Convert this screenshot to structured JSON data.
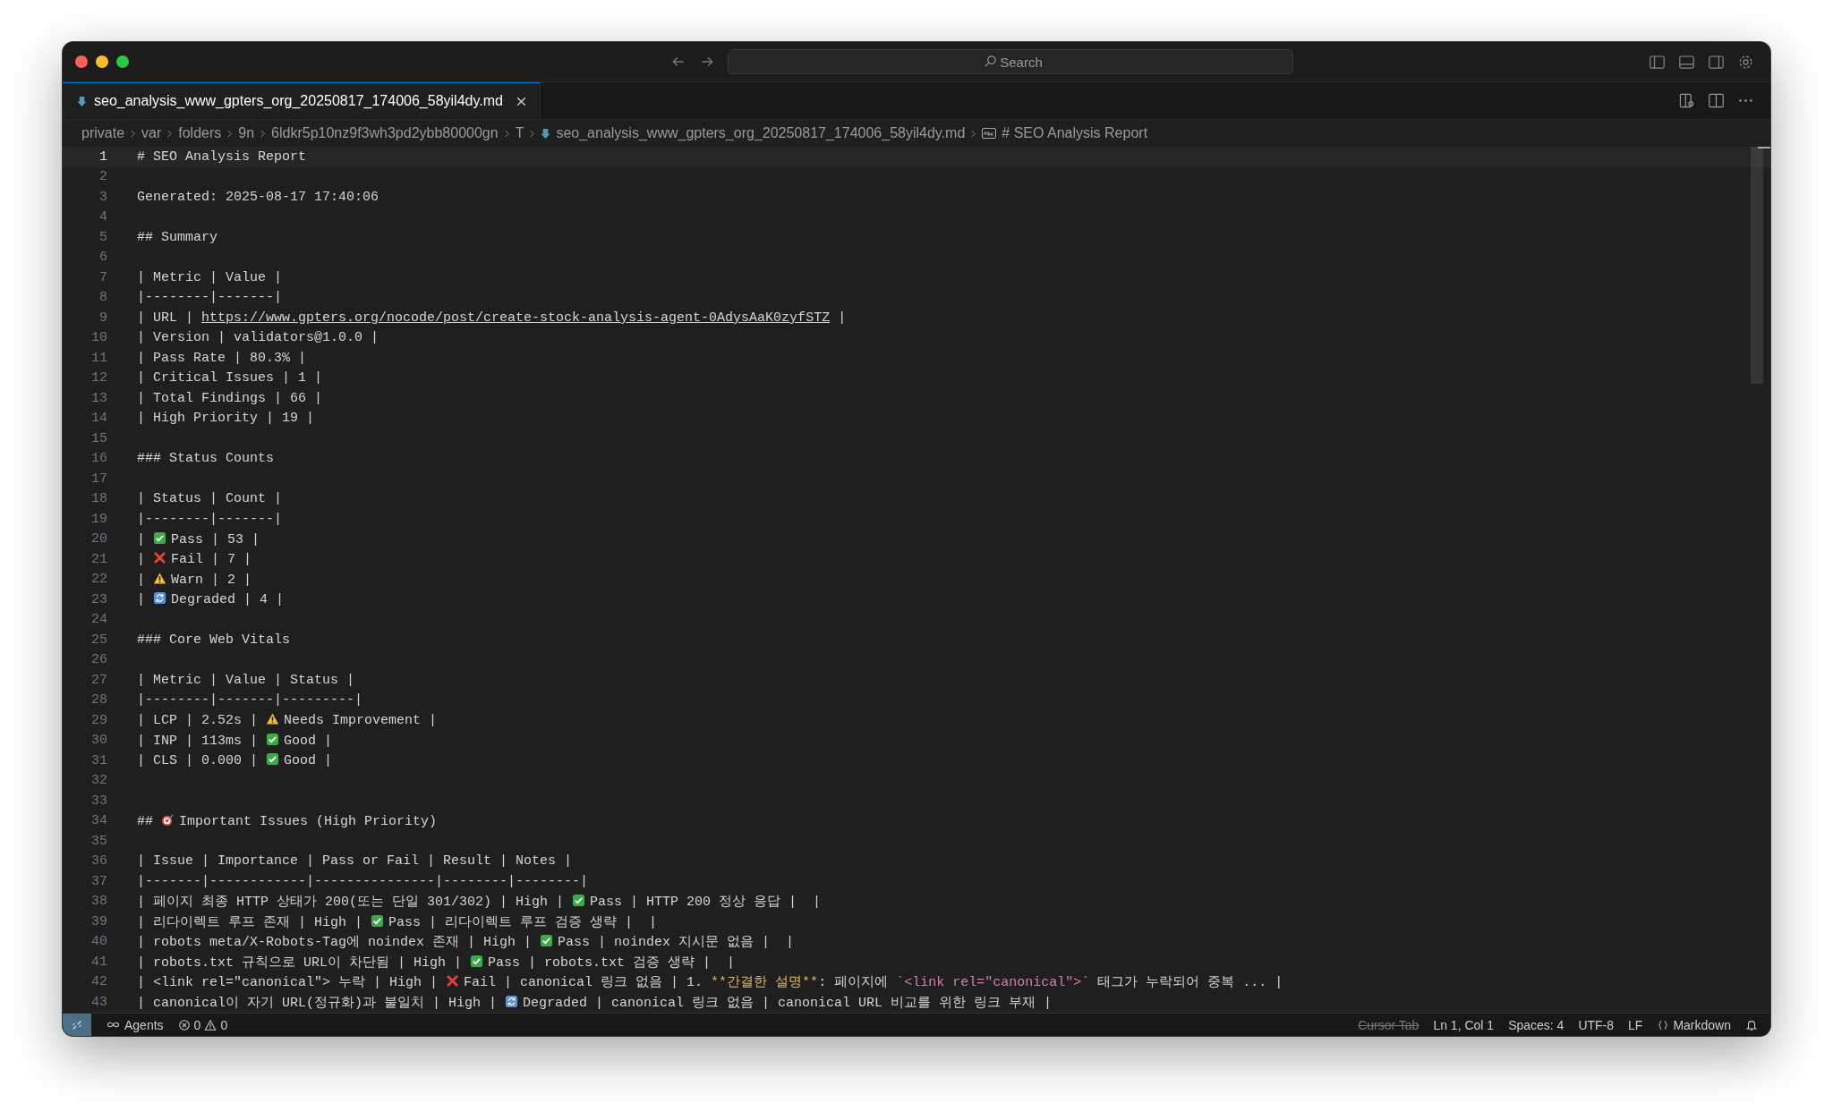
{
  "window": {
    "search": {
      "placeholder": "Search"
    }
  },
  "tabs": [
    {
      "label": "seo_analysis_www_gpters_org_20250817_174006_58yil4dy.md",
      "selected": true
    }
  ],
  "breadcrumb": [
    {
      "kind": "folder",
      "label": "private"
    },
    {
      "kind": "folder",
      "label": "var"
    },
    {
      "kind": "folder",
      "label": "folders"
    },
    {
      "kind": "folder",
      "label": "9n"
    },
    {
      "kind": "folder",
      "label": "6ldkr5p10nz9f3wh3pd2ybb80000gn"
    },
    {
      "kind": "folder",
      "label": "T"
    },
    {
      "kind": "file",
      "label": "seo_analysis_www_gpters_org_20250817_174006_58yil4dy.md"
    },
    {
      "kind": "symbol",
      "label": "# SEO Analysis Report"
    }
  ],
  "lines": [
    {
      "number": "1",
      "current": true,
      "text": "# SEO Analysis Report"
    },
    {
      "number": "2",
      "current": false
    },
    {
      "number": "3",
      "current": false,
      "text": "Generated: 2025-08-17 17:40:06"
    },
    {
      "number": "4",
      "current": false
    },
    {
      "number": "5",
      "current": false,
      "text": "## Summary"
    },
    {
      "number": "6",
      "current": false
    },
    {
      "number": "7",
      "current": false,
      "text": "| Metric | Value |"
    },
    {
      "number": "8",
      "current": false,
      "text": "|--------|-------|"
    },
    {
      "number": "9",
      "current": false,
      "parts": [
        {
          "kind": "text",
          "text": "| URL | "
        },
        {
          "kind": "link",
          "text": "https://www.gpters.org/nocode/post/create-stock-analysis-agent-0AdysAaK0zyfSTZ"
        },
        {
          "kind": "text",
          "text": " |"
        }
      ]
    },
    {
      "number": "10",
      "current": false,
      "text": "| Version | validators@1.0.0 |"
    },
    {
      "number": "11",
      "current": false,
      "text": "| Pass Rate | 80.3% |"
    },
    {
      "number": "12",
      "current": false,
      "text": "| Critical Issues | 1 |"
    },
    {
      "number": "13",
      "current": false,
      "text": "| Total Findings | 66 |"
    },
    {
      "number": "14",
      "current": false,
      "text": "| High Priority | 19 |"
    },
    {
      "number": "15",
      "current": false
    },
    {
      "number": "16",
      "current": false,
      "text": "### Status Counts"
    },
    {
      "number": "17",
      "current": false
    },
    {
      "number": "18",
      "current": false,
      "text": "| Status | Count |"
    },
    {
      "number": "19",
      "current": false,
      "text": "|--------|-------|"
    },
    {
      "number": "20",
      "current": false,
      "parts": [
        {
          "kind": "text",
          "text": "|"
        },
        {
          "kind": "pass"
        },
        {
          "kind": "text",
          "text": "Pass | 53 |"
        }
      ]
    },
    {
      "number": "21",
      "current": false,
      "parts": [
        {
          "kind": "text",
          "text": "|"
        },
        {
          "kind": "fail"
        },
        {
          "kind": "text",
          "text": "Fail | 7 |"
        }
      ]
    },
    {
      "number": "22",
      "current": false,
      "parts": [
        {
          "kind": "text",
          "text": "|"
        },
        {
          "kind": "warn"
        },
        {
          "kind": "text",
          "text": "Warn | 2 |"
        }
      ]
    },
    {
      "number": "23",
      "current": false,
      "parts": [
        {
          "kind": "text",
          "text": "|"
        },
        {
          "kind": "degraded"
        },
        {
          "kind": "text",
          "text": "Degraded | 4 |"
        }
      ]
    },
    {
      "number": "24",
      "current": false
    },
    {
      "number": "25",
      "current": false,
      "text": "### Core Web Vitals"
    },
    {
      "number": "26",
      "current": false
    },
    {
      "number": "27",
      "current": false,
      "text": "| Metric | Value | Status |"
    },
    {
      "number": "28",
      "current": false,
      "text": "|--------|-------|---------|"
    },
    {
      "number": "29",
      "current": false,
      "parts": [
        {
          "kind": "text",
          "text": "| LCP | 2.52s |"
        },
        {
          "kind": "warn"
        },
        {
          "kind": "text",
          "text": "Needs Improvement |"
        }
      ]
    },
    {
      "number": "30",
      "current": false,
      "parts": [
        {
          "kind": "text",
          "text": "| INP | 113ms |"
        },
        {
          "kind": "pass"
        },
        {
          "kind": "text",
          "text": "Good |"
        }
      ]
    },
    {
      "number": "31",
      "current": false,
      "parts": [
        {
          "kind": "text",
          "text": "| CLS | 0.000 |"
        },
        {
          "kind": "pass"
        },
        {
          "kind": "text",
          "text": "Good |"
        }
      ]
    },
    {
      "number": "32",
      "current": false
    },
    {
      "number": "33",
      "current": false
    },
    {
      "number": "34",
      "current": false,
      "parts": [
        {
          "kind": "text",
          "text": "##"
        },
        {
          "kind": "target"
        },
        {
          "kind": "text",
          "text": "Important Issues (High Priority)"
        }
      ]
    },
    {
      "number": "35",
      "current": false
    },
    {
      "number": "36",
      "current": false,
      "text": "| Issue | Importance | Pass or Fail | Result | Notes |"
    },
    {
      "number": "37",
      "current": false,
      "text": "|-------|------------|---------------|--------|--------|"
    },
    {
      "number": "38",
      "current": false,
      "parts": [
        {
          "kind": "text",
          "text": "| 페이지 최종 HTTP 상태가 200(또는 단일 301/302) | High |"
        },
        {
          "kind": "pass"
        },
        {
          "kind": "text",
          "text": "Pass | HTTP 200 정상 응답 |  |"
        }
      ]
    },
    {
      "number": "39",
      "current": false,
      "parts": [
        {
          "kind": "text",
          "text": "| 리다이렉트 루프 존재 | High |"
        },
        {
          "kind": "pass"
        },
        {
          "kind": "text",
          "text": "Pass | 리다이렉트 루프 검증 생략 |  |"
        }
      ]
    },
    {
      "number": "40",
      "current": false,
      "parts": [
        {
          "kind": "text",
          "text": "| robots meta/X-Robots-Tag에 noindex 존재 | High |"
        },
        {
          "kind": "pass"
        },
        {
          "kind": "text",
          "text": "Pass | noindex 지시문 없음 |  |"
        }
      ]
    },
    {
      "number": "41",
      "current": false,
      "parts": [
        {
          "kind": "text",
          "text": "| robots.txt 규칙으로 URL이 차단됨 | High |"
        },
        {
          "kind": "pass"
        },
        {
          "kind": "text",
          "text": "Pass | robots.txt 검증 생략 |  |"
        }
      ]
    },
    {
      "number": "42",
      "current": false,
      "parts": [
        {
          "kind": "text",
          "text": "| <link rel=\"canonical\"> 누락 | High |"
        },
        {
          "kind": "fail"
        },
        {
          "kind": "text",
          "text": "Fail | canonical 링크 없음 | 1. "
        },
        {
          "kind": "bold",
          "text": "**간결한 설명**"
        },
        {
          "kind": "text",
          "text": ": 페이지에 "
        },
        {
          "kind": "code",
          "text": "`<link rel=\"canonical\">`"
        },
        {
          "kind": "text",
          "text": " 태그가 누락되어 중복 ... |"
        }
      ]
    },
    {
      "number": "43",
      "current": false,
      "parts": [
        {
          "kind": "text",
          "text": "| canonical이 자기 URL(정규화)과 불일치 | High |"
        },
        {
          "kind": "degraded"
        },
        {
          "kind": "text",
          "text": "Degraded | canonical 링크 없음 | canonical URL 비교를 위한 링크 부재 |"
        }
      ]
    }
  ],
  "status_bar": {
    "agents": "Agents",
    "errors": "0",
    "warnings": "0",
    "items": [
      {
        "label": "Cursor Tab",
        "disabled": true
      },
      {
        "label": "Ln 1, Col 1",
        "disabled": false
      },
      {
        "label": "Spaces: 4",
        "disabled": false
      },
      {
        "label": "UTF-8",
        "disabled": false
      },
      {
        "label": "LF",
        "disabled": false
      }
    ],
    "language": "Markdown"
  }
}
